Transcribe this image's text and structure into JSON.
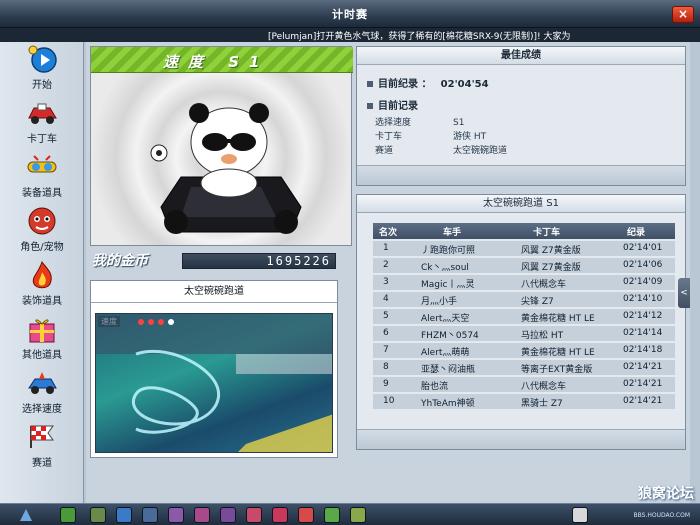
{
  "window": {
    "title": "计时赛",
    "close_label": "×"
  },
  "ticker": {
    "message": "[Pelumjan]打开黄色水气球，获得了稀有的[棉花糖SRX-9(无限制)]! 大家为"
  },
  "sidebar": {
    "items": [
      {
        "label": "开始",
        "icon": "start-icon"
      },
      {
        "label": "卡丁车",
        "icon": "kart-icon"
      },
      {
        "label": "装备道具",
        "icon": "goggles-icon"
      },
      {
        "label": "角色/宠物",
        "icon": "character-icon"
      },
      {
        "label": "装饰道具",
        "icon": "fire-icon"
      },
      {
        "label": "其他道具",
        "icon": "giftbox-icon"
      },
      {
        "label": "选择速度",
        "icon": "speed-kart-icon"
      },
      {
        "label": "赛道",
        "icon": "flag-icon"
      }
    ]
  },
  "character_panel": {
    "speed_banner": "速度 S1"
  },
  "coins": {
    "label": "我的金币",
    "value": "1695226"
  },
  "track": {
    "name": "太空碗碗跑道",
    "speed_overlay": "速度"
  },
  "best": {
    "title": "最佳成绩",
    "current_record_label": "目前纪录 ：",
    "current_record_value": "02'04'54",
    "current_records_label": "目前记录",
    "rows": [
      {
        "key": "选择速度",
        "value": "S1"
      },
      {
        "key": "卡丁车",
        "value": "游侠 HT"
      },
      {
        "key": "赛道",
        "value": "太空碗碗跑道"
      }
    ]
  },
  "ranking": {
    "title": "太空碗碗跑道 S1",
    "headers": {
      "rank": "名次",
      "racer": "车手",
      "kart": "卡丁车",
      "record": "纪录"
    },
    "rows": [
      {
        "rank": "1",
        "racer": "丿跑跑你可照",
        "kart": "风翼 Z7黄金版",
        "record": "02'14'01"
      },
      {
        "rank": "2",
        "racer": "Ck丶灬soul",
        "kart": "风翼 Z7黄金版",
        "record": "02'14'06"
      },
      {
        "rank": "3",
        "racer": "Magic丨灬灵",
        "kart": "八代概念车",
        "record": "02'14'09"
      },
      {
        "rank": "4",
        "racer": "月灬小手",
        "kart": "尖锋 Z7",
        "record": "02'14'10"
      },
      {
        "rank": "5",
        "racer": "Alert灬天空",
        "kart": "黄金棉花糖 HT LE",
        "record": "02'14'12"
      },
      {
        "rank": "6",
        "racer": "FHZM丶0574",
        "kart": "马拉松 HT",
        "record": "02'14'14"
      },
      {
        "rank": "7",
        "racer": "Alert灬萌萌",
        "kart": "黄金棉花糖 HT LE",
        "record": "02'14'18"
      },
      {
        "rank": "8",
        "racer": "亚瑟丶闷油瓶",
        "kart": "等离子EXT黄金版",
        "record": "02'14'21"
      },
      {
        "rank": "9",
        "racer": "胎也流",
        "kart": "八代概念车",
        "record": "02'14'21"
      },
      {
        "rank": "10",
        "racer": "YhTeAm神顿",
        "kart": "黑骑士 Z7",
        "record": "02'14'21"
      }
    ]
  },
  "side_tab": {
    "label": "<"
  },
  "watermark": {
    "text": "狼窝论坛",
    "sub": "BBS.HOUDAO.COM"
  },
  "colors": {
    "banner_green": "#8fd13a",
    "table_header": "#4d5e72",
    "row_bg": "#c6d0db",
    "close_red": "#d8391c"
  }
}
